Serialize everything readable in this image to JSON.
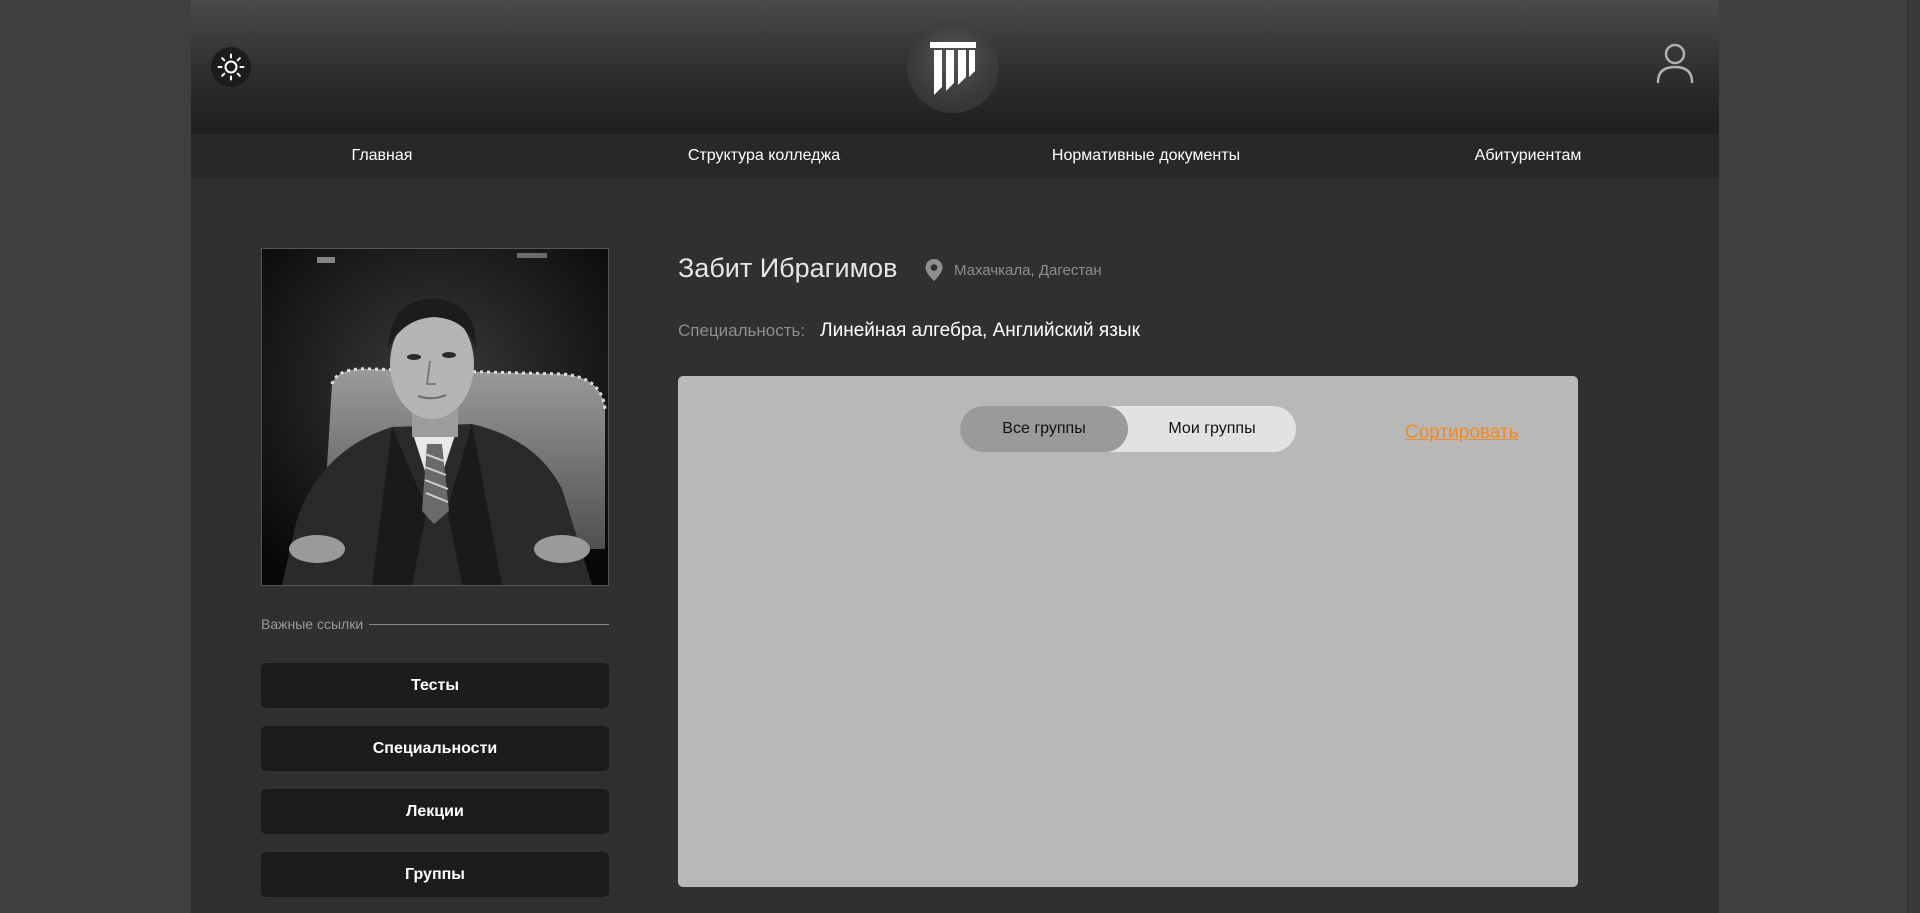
{
  "header": {
    "theme_icon": "sun-icon",
    "logo_icon": "college-columns-logo",
    "user_icon": "user-icon"
  },
  "nav": {
    "items": [
      {
        "label": "Главная"
      },
      {
        "label": "Структура колледжа"
      },
      {
        "label": "Нормативные документы"
      },
      {
        "label": "Абитуриентам"
      }
    ]
  },
  "profile": {
    "name": "Забит Ибрагимов",
    "location": "Махачкала, Дагестан",
    "specialty_label": "Специальность:",
    "specialty_value": "Линейная алгебра, Английский язык"
  },
  "sidebar": {
    "links_heading": "Важные ссылки",
    "buttons": [
      {
        "label": "Тесты"
      },
      {
        "label": "Специальности"
      },
      {
        "label": "Лекции"
      },
      {
        "label": "Группы"
      }
    ]
  },
  "groups": {
    "tabs": [
      {
        "label": "Все группы",
        "active": true
      },
      {
        "label": "Мои группы",
        "active": false
      }
    ],
    "sort_label": "Сортировать"
  },
  "colors": {
    "accent": "#f28a1e",
    "page_bg": "#303030",
    "panel_bg": "#b8b8b8"
  }
}
